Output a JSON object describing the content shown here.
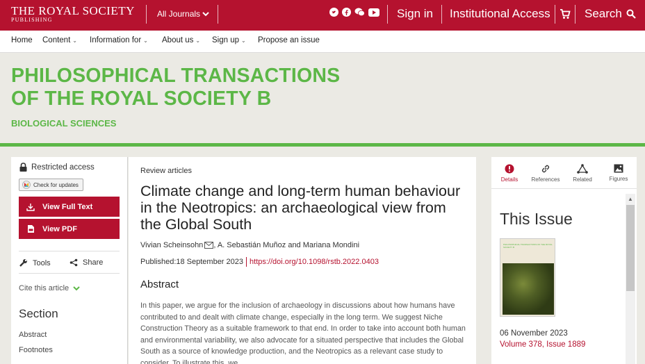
{
  "header": {
    "logo_main": "THE ROYAL SOCIETY",
    "logo_sub": "PUBLISHING",
    "journals_label": "All Journals",
    "social_icons": [
      "twitter-icon",
      "facebook-icon",
      "wechat-icon",
      "youtube-icon"
    ],
    "sign_in": "Sign in",
    "institutional_access": "Institutional Access",
    "search": "Search"
  },
  "nav": {
    "items": [
      {
        "label": "Home",
        "dropdown": false
      },
      {
        "label": "Content",
        "dropdown": true
      },
      {
        "label": "Information for",
        "dropdown": true
      },
      {
        "label": "About us",
        "dropdown": true
      },
      {
        "label": "Sign up",
        "dropdown": true
      },
      {
        "label": "Propose an issue",
        "dropdown": false
      }
    ]
  },
  "journal": {
    "title_line1": "PHILOSOPHICAL TRANSACTIONS",
    "title_line2": "OF THE ROYAL SOCIETY B",
    "subtitle": "BIOLOGICAL SCIENCES"
  },
  "left": {
    "restricted": "Restricted access",
    "check_updates": "Check for updates",
    "view_full_text": "View Full Text",
    "view_pdf": "View PDF",
    "tools": "Tools",
    "share": "Share",
    "cite": "Cite this article",
    "section_title": "Section",
    "section_links": [
      "Abstract",
      "Footnotes"
    ]
  },
  "article": {
    "kicker": "Review articles",
    "title": "Climate change and long-term human behaviour in the Neotropics: an archaeological view from the Global South",
    "author1": "Vivian Scheinsohn",
    "authors_rest": ", A. Sebastián Muñoz and Mariana Mondini",
    "published_label": "Published:",
    "published_date": "18 September 2023",
    "doi": "https://doi.org/10.1098/rstb.2022.0403",
    "abstract_title": "Abstract",
    "abstract_text": "In this paper, we argue for the inclusion of archaeology in discussions about how humans have contributed to and dealt with climate change, especially in the long term. We suggest Niche Construction Theory as a suitable framework to that end. In order to take into account both human and environmental variability, we also advocate for a situated perspective that includes the Global South as a source of knowledge production, and the Neotropics as a relevant case study to consider. To illustrate this, we"
  },
  "right": {
    "tabs": [
      {
        "label": "Details",
        "icon": "info-icon",
        "active": true
      },
      {
        "label": "References",
        "icon": "link-icon",
        "active": false
      },
      {
        "label": "Related",
        "icon": "related-icon",
        "active": false
      },
      {
        "label": "Figures",
        "icon": "image-icon",
        "active": false
      }
    ],
    "heading": "This Issue",
    "cover_text": "PHILOSOPHICAL TRANSACTIONS OF THE ROYAL SOCIETY B",
    "issue_date": "06 November 2023",
    "issue_volume": "Volume 378, Issue 1889"
  },
  "colors": {
    "brand_red": "#b5122f",
    "journal_green": "#5cb747",
    "background": "#ebeae4"
  }
}
